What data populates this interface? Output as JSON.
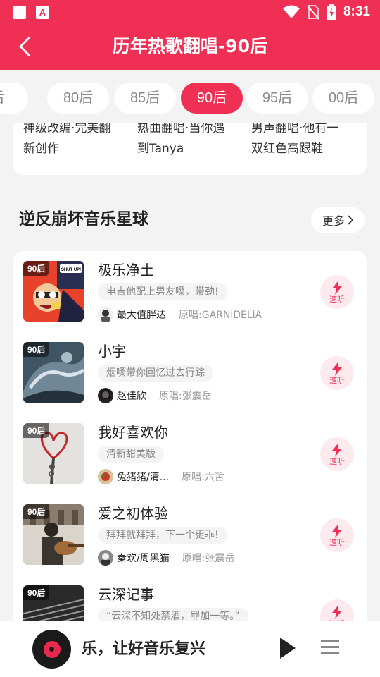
{
  "status_bar": {
    "time": "8:31",
    "app_badge": "A"
  },
  "header": {
    "title": "历年热歌翻唱-90后"
  },
  "tabs": [
    {
      "label": "后"
    },
    {
      "label": "80后"
    },
    {
      "label": "85后"
    },
    {
      "label": "90后",
      "active": true
    },
    {
      "label": "95后"
    },
    {
      "label": "00后"
    }
  ],
  "top_items": [
    {
      "line1": "神级改编·完美翻",
      "line2": "新创作"
    },
    {
      "line1": "热曲翻唱·当你遇",
      "line2": "到Tanya"
    },
    {
      "line1": "男声翻唱·他有一",
      "line2": "双红色高跟鞋"
    }
  ],
  "section": {
    "title": "逆反崩坏音乐星球",
    "more_label": "更多"
  },
  "songs": [
    {
      "tag": "90后",
      "title": "极乐净土",
      "desc": "电吉他配上男友嗓，带劲!",
      "singer": "最大值胖达",
      "original": "原唱:GARNiDELiA",
      "quick_label": "速听"
    },
    {
      "tag": "90后",
      "title": "小宇",
      "desc": "烟嗓带你回忆过去行踪",
      "singer": "赵佳欣",
      "original": "原唱:张震岳",
      "quick_label": "速听"
    },
    {
      "tag": "90后",
      "title": "我好喜欢你",
      "desc": "清新甜美版",
      "singer": "兔猪猪/清...",
      "original": "原唱:六哲",
      "quick_label": "速听"
    },
    {
      "tag": "90后",
      "title": "爱之初体验",
      "desc": "拜拜就拜拜，下一个更乖!",
      "singer": "秦欢/周黑猫",
      "original": "原唱:张震岳",
      "quick_label": "速听"
    },
    {
      "tag": "90后",
      "title": "云深记事",
      "desc": "“云深不知处禁酒，罪加一等。”",
      "singer": "",
      "original": "",
      "quick_label": "速听"
    }
  ],
  "thumb1_text": "SHUT UP!",
  "player": {
    "text": "乐，让好音乐复兴"
  },
  "colors": {
    "brand": "#f02f55",
    "background": "#f3f3f3"
  }
}
